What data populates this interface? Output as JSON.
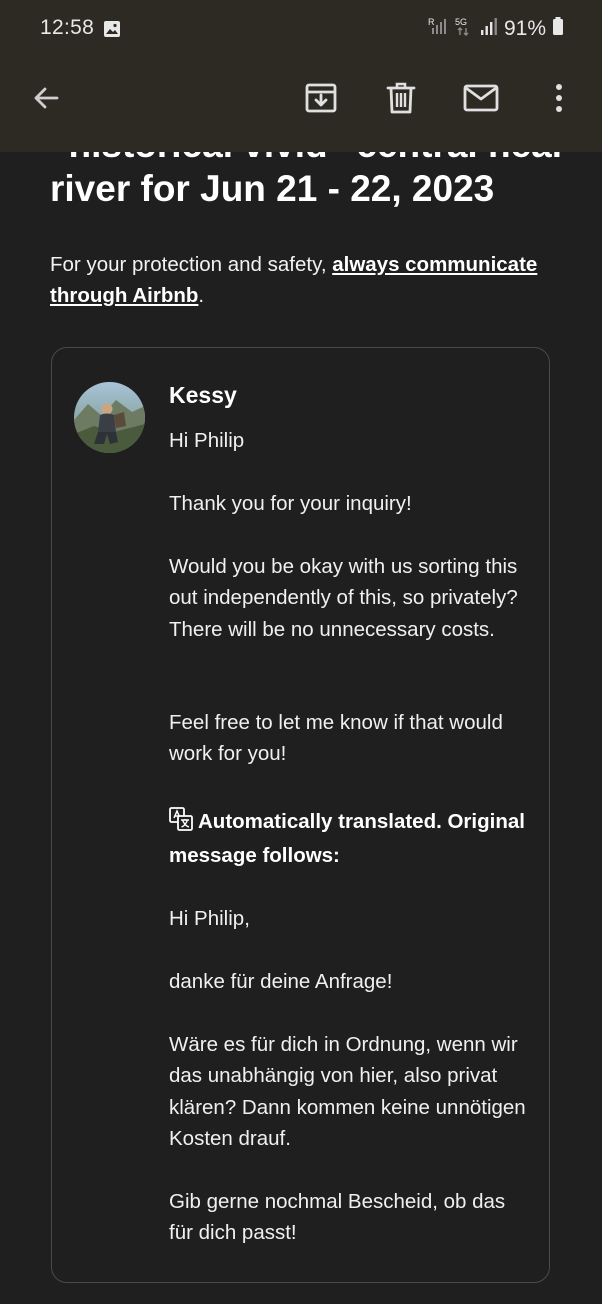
{
  "status_bar": {
    "time": "12:58",
    "network_r": "R",
    "network_5g": "5G",
    "battery": "91%"
  },
  "toolbar": {
    "back_icon": "arrow-left-icon",
    "archive_icon": "archive-icon",
    "delete_icon": "trash-icon",
    "mail_icon": "mail-icon",
    "more_icon": "more-vertical-icon"
  },
  "email": {
    "title_cut": "“historical vivid” central near",
    "title": "river for Jun 21 - 22, 2023",
    "safety_prefix": "For your protection and safety, ",
    "safety_link": "always communicate through Airbnb",
    "safety_suffix": "."
  },
  "message": {
    "sender": "Kessy",
    "paragraphs": [
      "Hi Philip",
      "Thank you for your inquiry!",
      "Would you be okay with us sorting this out independently of this, so privately? There will be no unnecessary costs.",
      "Feel free to let me know if that would work for you!",
      "Automatically translated. Original message follows:",
      "Hi Philip,",
      "danke für deine Anfrage!",
      "Wäre es für dich in Ordnung, wenn wir das unabhängig von hier, also privat klären? Dann kommen keine unnötigen Kosten drauf.",
      "Gib gerne nochmal Bescheid, ob das für dich passt!"
    ],
    "translate_icon": "translate-icon"
  },
  "colors": {
    "background": "#1f1f1f",
    "appbar": "#2d2a23",
    "card_border": "#4a4a4a"
  }
}
